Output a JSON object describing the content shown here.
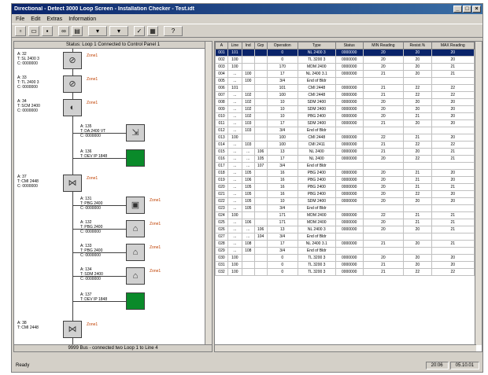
{
  "window": {
    "title": "Directional - Detect 3000 Loop Screen - Installation Checker - Test.idt"
  },
  "menu": [
    "File",
    "Edit",
    "Extras",
    "Information"
  ],
  "left_panel": {
    "header": "Status: Loop 1 Connected to Control Panel 1",
    "footer": "9999 Bus - connected two Loop 1 to Line 4",
    "devices": [
      {
        "label": "A: 32\nT: SL 2400 3\nC: 0000000",
        "zone": "Zone1",
        "icon": "sensor-icon",
        "green": false
      },
      {
        "label": "A: 33\nT: TL 2400 3\nC: 0000000",
        "zone": "Zone1",
        "icon": "sensor-icon",
        "green": false
      },
      {
        "label": "A: 34\nT: SCM 2400\nC: 0000000",
        "zone": "Zone1",
        "icon": "horn-icon",
        "green": false
      },
      {
        "label": "A: 135\nT: DA 2400 VT\nC: 0000000",
        "zone": "",
        "icon": "relay-icon",
        "green": false
      },
      {
        "label": "A: 136\nT: DEV IP 1848",
        "zone": "",
        "icon": "",
        "green": true
      },
      {
        "label": "A: 37\nT: CMI 2448\nC: 0000000",
        "zone": "Zone1",
        "icon": "isolator-icon",
        "green": false
      },
      {
        "label": "A: 131\nT: PBG 2400\nC: 0000000",
        "zone": "Zone1",
        "icon": "box-icon",
        "green": false
      },
      {
        "label": "A: 132\nT: PBG 2400\nC: 0000000",
        "zone": "Zone1",
        "icon": "house-icon",
        "green": false
      },
      {
        "label": "A: 133\nT: PBG 2400\nC: 0000000",
        "zone": "Zone1",
        "icon": "house-icon",
        "green": false
      },
      {
        "label": "A: 134\nT: SDM 2400\nC: 0000000",
        "zone": "Zone1",
        "icon": "house-icon",
        "green": false
      },
      {
        "label": "A: 137\nT: DEV IP 1848",
        "zone": "",
        "icon": "",
        "green": true
      },
      {
        "label": "A: 38\nT: CMI 2448",
        "zone": "Zone1",
        "icon": "isolator-icon",
        "green": false
      }
    ]
  },
  "grid": {
    "headers": [
      "A",
      "Line",
      "Ind",
      "Grp",
      "Operation",
      "Type",
      "Status",
      "MIN Reading",
      "Resist.%",
      "MAX Reading"
    ],
    "rows": [
      [
        "001",
        "101",
        "",
        "",
        "0",
        "NL 2400 3",
        "0000000",
        "20",
        "20",
        "20"
      ],
      [
        "002",
        "100",
        "",
        "",
        "0",
        "TL 3200 3",
        "0000000",
        "20",
        "20",
        "20"
      ],
      [
        "003",
        "100",
        "",
        "",
        "170",
        "MDM 2400",
        "0000000",
        "20",
        "20",
        "21"
      ],
      [
        "004",
        "...",
        "100",
        "",
        "17",
        "NL 2400 3.1",
        "0000000",
        "21",
        "20",
        "21"
      ],
      [
        "005",
        "...",
        "100",
        "",
        "3/4",
        "End of Bldr",
        "",
        "",
        "",
        ""
      ],
      [
        "006",
        "101",
        "",
        "",
        "101",
        "CMI 2448",
        "0000000",
        "21",
        "22",
        "22"
      ],
      [
        "007",
        "...",
        "102",
        "",
        "100",
        "CMI 2448",
        "0000000",
        "21",
        "22",
        "22"
      ],
      [
        "008",
        "...",
        "102",
        "",
        "10",
        "SDM 2400",
        "0000000",
        "20",
        "20",
        "20"
      ],
      [
        "009",
        "...",
        "102",
        "",
        "10",
        "SDM 2400",
        "0000000",
        "20",
        "20",
        "20"
      ],
      [
        "010",
        "...",
        "102",
        "",
        "10",
        "PBG 2400",
        "0000000",
        "20",
        "21",
        "20"
      ],
      [
        "011",
        "...",
        "103",
        "",
        "17",
        "SDM 2400",
        "0000000",
        "21",
        "20",
        "20"
      ],
      [
        "012",
        "...",
        "103",
        "",
        "3/4",
        "End of Bldr",
        "",
        "",
        "",
        ""
      ],
      [
        "013",
        "100",
        "",
        "",
        "100",
        "CMI 2448",
        "0000000",
        "22",
        "21",
        "20"
      ],
      [
        "014",
        "...",
        "103",
        "",
        "100",
        "CMI 2411",
        "0000000",
        "21",
        "22",
        "22"
      ],
      [
        "015",
        "...",
        "...",
        "106",
        "13",
        "NL 2400",
        "0000000",
        "21",
        "20",
        "21"
      ],
      [
        "016",
        "...",
        "...",
        "105",
        "17",
        "NL 2400",
        "0000000",
        "20",
        "22",
        "21"
      ],
      [
        "017",
        "...",
        "...",
        "107",
        "3/4",
        "End of Bldr",
        "",
        "",
        "",
        ""
      ],
      [
        "018",
        "...",
        "105",
        "",
        "16",
        "PBG 2400",
        "0000000",
        "20",
        "21",
        "20"
      ],
      [
        "019",
        "...",
        "106",
        "",
        "16",
        "PBG 2400",
        "0000000",
        "20",
        "21",
        "20"
      ],
      [
        "020",
        "...",
        "105",
        "",
        "16",
        "PBG 2400",
        "0000000",
        "20",
        "21",
        "21"
      ],
      [
        "021",
        "...",
        "105",
        "",
        "16",
        "PBG 2400",
        "0000000",
        "20",
        "22",
        "20"
      ],
      [
        "022",
        "...",
        "105",
        "",
        "10",
        "SDM 2400",
        "0000000",
        "20",
        "20",
        "20"
      ],
      [
        "023",
        "...",
        "105",
        "",
        "3/4",
        "End of Bldr",
        "",
        "",
        "",
        ""
      ],
      [
        "024",
        "100",
        "",
        "",
        "171",
        "MDM 2400",
        "0000000",
        "22",
        "21",
        "21"
      ],
      [
        "025",
        "...",
        "106",
        "",
        "171",
        "MDM 2400",
        "0000000",
        "20",
        "21",
        "21"
      ],
      [
        "026",
        "...",
        "...",
        "106",
        "13",
        "NL 2400 3",
        "0000000",
        "20",
        "20",
        "21"
      ],
      [
        "027",
        "...",
        "...",
        "104",
        "3/4",
        "End of Bldr",
        "",
        "",
        "",
        ""
      ],
      [
        "028",
        "...",
        "108",
        "",
        "17",
        "NL 2400 3.1",
        "0000000",
        "21",
        "20",
        "21"
      ],
      [
        "029",
        "...",
        "108",
        "",
        "3/4",
        "End of Bldr",
        "",
        "",
        "",
        ""
      ],
      [
        "030",
        "100",
        "",
        "",
        "0",
        "TL 3200 3",
        "0000000",
        "20",
        "20",
        "20"
      ],
      [
        "031",
        "100",
        "",
        "",
        "0",
        "TL 3200 3",
        "0000000",
        "21",
        "20",
        "20"
      ],
      [
        "032",
        "100",
        "",
        "",
        "0",
        "TL 3200 3",
        "0000000",
        "21",
        "22",
        "22"
      ]
    ]
  },
  "status": {
    "ready": "Ready",
    "cell1": "",
    "time": "20:06",
    "date": "05.10.01"
  }
}
